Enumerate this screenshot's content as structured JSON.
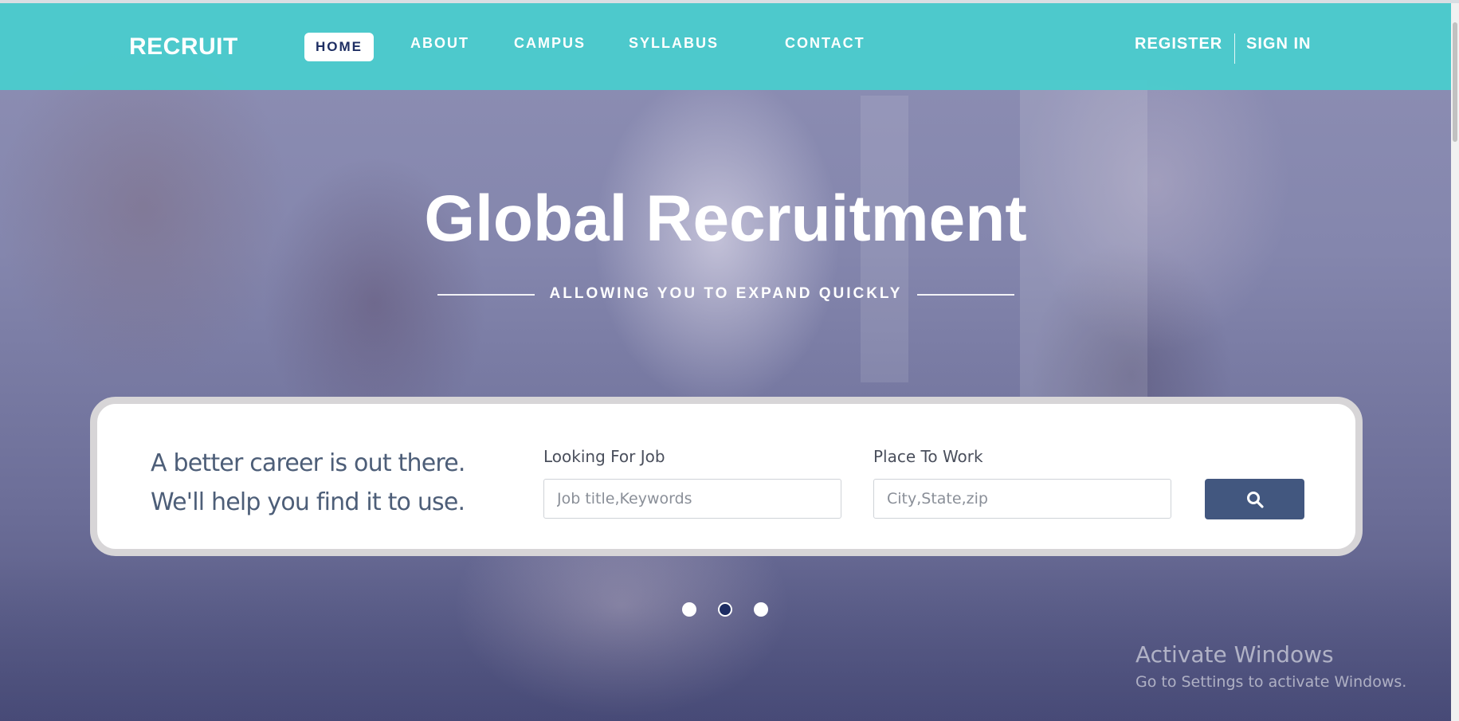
{
  "nav": {
    "brand": "RECRUIT",
    "items": [
      {
        "label": "HOME",
        "active": true
      },
      {
        "label": "ABOUT",
        "active": false
      },
      {
        "label": "CAMPUS",
        "active": false
      },
      {
        "label": "SYLLABUS",
        "active": false
      },
      {
        "label": "CONTACT",
        "active": false
      }
    ],
    "register_label": "REGISTER",
    "signin_label": "SIGN IN"
  },
  "hero": {
    "title": "Global Recruitment",
    "subtitle": "ALLOWING YOU TO EXPAND QUICKLY"
  },
  "search": {
    "tagline": "A better career is out there. We'll help you find it to use.",
    "job_label": "Looking For Job",
    "job_placeholder": "Job title,Keywords",
    "job_value": "",
    "place_label": "Place To Work",
    "place_placeholder": "City,State,zip",
    "place_value": "",
    "button_icon": "search-icon"
  },
  "carousel": {
    "slide_count": 3,
    "active_index": 1
  },
  "watermark": {
    "title": "Activate Windows",
    "subtitle": "Go to Settings to activate Windows."
  },
  "colors": {
    "navbar": "#48cece",
    "active_nav_text": "#1e2e63",
    "search_button": "#42577f",
    "active_dot": "#1e2d63"
  }
}
